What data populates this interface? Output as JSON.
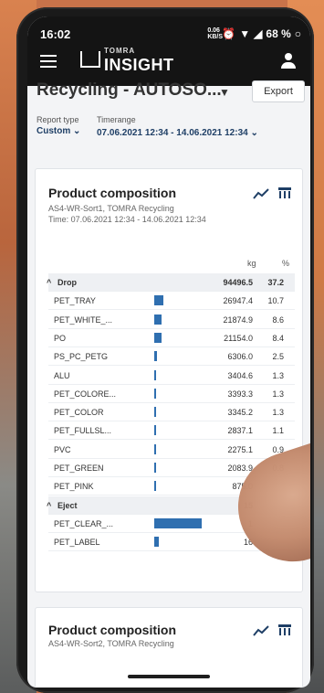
{
  "status_bar": {
    "time": "16:02",
    "data_speed": "0.06 KB/S",
    "battery": "68 %"
  },
  "app_bar": {
    "logo_small": "TOMRA",
    "logo_main": "INSIGHT"
  },
  "header": {
    "title": "Recycling - AUTOSO...",
    "export_label": "Export",
    "report_type_label": "Report type",
    "report_type_value": "Custom",
    "timerange_label": "Timerange",
    "timerange_value": "07.06.2021 12:34 - 14.06.2021 12:34"
  },
  "card1": {
    "title": "Product composition",
    "subtitle": "AS4-WR-Sort1, TOMRA Recycling",
    "time_line": "Time: 07.06.2021 12:34 - 14.06.2021 12:34",
    "col_kg": "kg",
    "col_pct": "%",
    "rows": [
      {
        "label": "Drop",
        "kg": "94496.5",
        "pct": "37.2",
        "group": true,
        "bar": 0
      },
      {
        "label": "PET_TRAY",
        "kg": "26947.4",
        "pct": "10.7",
        "group": false,
        "bar": 0.19
      },
      {
        "label": "PET_WHITE_...",
        "kg": "21874.9",
        "pct": "8.6",
        "group": false,
        "bar": 0.16
      },
      {
        "label": "PO",
        "kg": "21154.0",
        "pct": "8.4",
        "group": false,
        "bar": 0.16
      },
      {
        "label": "PS_PC_PETG",
        "kg": "6306.0",
        "pct": "2.5",
        "group": false,
        "bar": 0.05
      },
      {
        "label": "ALU",
        "kg": "3404.6",
        "pct": "1.3",
        "group": false,
        "bar": 0.03
      },
      {
        "label": "PET_COLORE...",
        "kg": "3393.3",
        "pct": "1.3",
        "group": false,
        "bar": 0.03
      },
      {
        "label": "PET_COLOR",
        "kg": "3345.2",
        "pct": "1.3",
        "group": false,
        "bar": 0.03
      },
      {
        "label": "PET_FULLSL...",
        "kg": "2837.1",
        "pct": "1.1",
        "group": false,
        "bar": 0.03
      },
      {
        "label": "PVC",
        "kg": "2275.1",
        "pct": "0.9",
        "group": false,
        "bar": 0.02
      },
      {
        "label": "PET_GREEN",
        "kg": "2083.9",
        "pct": "0.8",
        "group": false,
        "bar": 0.02
      },
      {
        "label": "PET_PINK",
        "kg": "875.0",
        "pct": "",
        "group": false,
        "bar": 0.01
      },
      {
        "label": "Eject",
        "kg": "15",
        "pct": "",
        "group": true,
        "bar": 0
      },
      {
        "label": "PET_CLEAR_...",
        "kg": "1",
        "pct": "",
        "group": false,
        "bar": 1.0
      },
      {
        "label": "PET_LABEL",
        "kg": "16",
        "pct": "",
        "group": false,
        "bar": 0.09
      }
    ]
  },
  "card2": {
    "title": "Product composition",
    "subtitle": "AS4-WR-Sort2, TOMRA Recycling"
  },
  "colors": {
    "bar": "#2f6fb0",
    "accent": "#1f3f66"
  }
}
